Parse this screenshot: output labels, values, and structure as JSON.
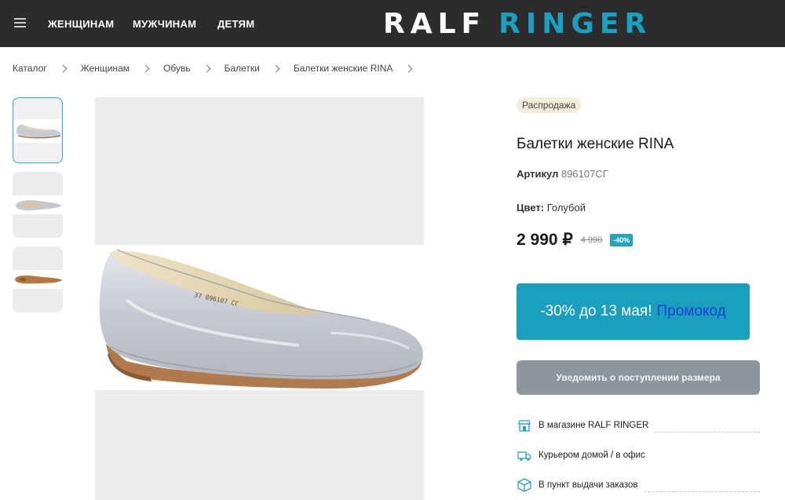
{
  "header": {
    "nav": [
      "ЖЕНЩИНАМ",
      "МУЖЧИНАМ",
      "ДЕТЯМ"
    ],
    "logo_part1": "RALF",
    "logo_part2": "RINGER"
  },
  "breadcrumb": [
    "Каталог",
    "Женщинам",
    "Обувь",
    "Балетки",
    "Балетки женские RINA"
  ],
  "product": {
    "badge": "Распродажа",
    "title": "Балетки женские RINA",
    "article_label": "Артикул",
    "article_value": "896107СГ",
    "color_label": "Цвет:",
    "color_value": "Голубой",
    "price": "2 990 ₽",
    "old_price": "4 990",
    "discount": "-40%"
  },
  "promo": {
    "text": "-30% до 13 мая!",
    "link": "Промокод"
  },
  "notify_button": "Уведомить о поступлении размера",
  "delivery": [
    {
      "label": "В магазине RALF RINGER",
      "icon": "store-icon"
    },
    {
      "label": "Курьером домой / в офис",
      "icon": "truck-icon"
    },
    {
      "label": "В пункт выдачи заказов",
      "icon": "box-icon"
    }
  ],
  "colors": {
    "header_bg": "#2c2c2c",
    "accent": "#1aa0be",
    "notify_bg": "#8f959c",
    "sale_badge_bg": "#f5ecd9"
  }
}
